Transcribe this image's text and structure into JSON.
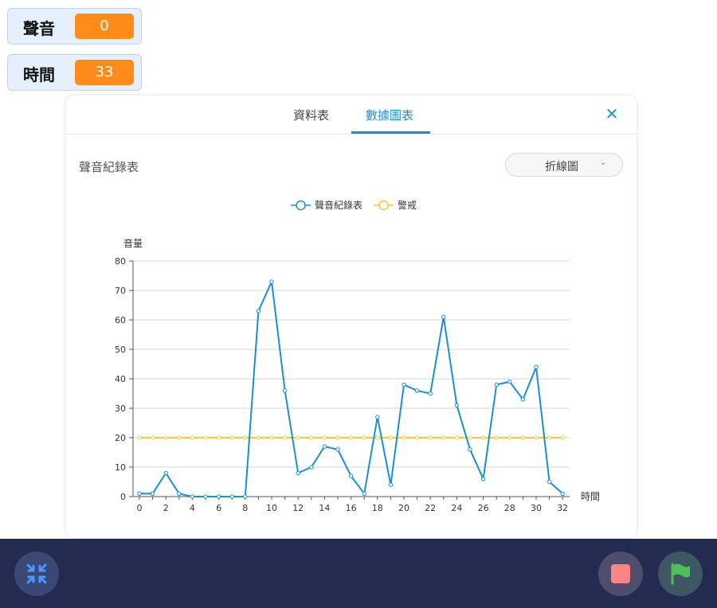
{
  "monitors": [
    {
      "label": "聲音",
      "value": "0"
    },
    {
      "label": "時間",
      "value": "33"
    }
  ],
  "dialog": {
    "tabs": [
      {
        "label": "資料表"
      },
      {
        "label": "數據圖表"
      }
    ],
    "active_tab": 1,
    "chart_name": "聲音紀錄表",
    "chart_type_select": "折線圖"
  },
  "colors": {
    "accent": "#1990d6",
    "series_main": "#1a8fd1",
    "series_warn": "#f6c93c",
    "monitor_value": "#ff8c1a",
    "bottom_bar": "#242b51"
  },
  "icons": {
    "close": "close-icon",
    "select_arrow": "chevron-down-icon",
    "shrink": "shrink-icon",
    "stop": "stop-icon",
    "flag": "green-flag-icon"
  },
  "chart_data": {
    "type": "line",
    "x": [
      0,
      1,
      2,
      3,
      4,
      5,
      6,
      7,
      8,
      9,
      10,
      11,
      12,
      13,
      14,
      15,
      16,
      17,
      18,
      19,
      20,
      21,
      22,
      23,
      24,
      25,
      26,
      27,
      28,
      29,
      30,
      31,
      32
    ],
    "series": [
      {
        "name": "聲音紀錄表",
        "color": "#1a8fd1",
        "values": [
          1,
          1,
          8,
          1,
          0,
          0,
          0,
          0,
          0,
          63,
          73,
          36,
          8,
          10,
          17,
          16,
          7,
          1,
          27,
          4,
          38,
          36,
          35,
          61,
          31,
          16,
          6,
          38,
          39,
          33,
          44,
          5,
          1
        ]
      },
      {
        "name": "警戒",
        "color": "#f6c93c",
        "values": [
          20,
          20,
          20,
          20,
          20,
          20,
          20,
          20,
          20,
          20,
          20,
          20,
          20,
          20,
          20,
          20,
          20,
          20,
          20,
          20,
          20,
          20,
          20,
          20,
          20,
          20,
          20,
          20,
          20,
          20,
          20,
          20,
          20
        ]
      }
    ],
    "xlabel": "時間",
    "ylabel": "音量",
    "ylim": [
      0,
      80
    ],
    "yticks": [
      0,
      10,
      20,
      30,
      40,
      50,
      60,
      70,
      80
    ],
    "xticks": [
      0,
      2,
      4,
      6,
      8,
      10,
      12,
      14,
      16,
      18,
      20,
      22,
      24,
      26,
      28,
      30,
      32
    ],
    "grid": true,
    "legend_position": "top-center"
  }
}
